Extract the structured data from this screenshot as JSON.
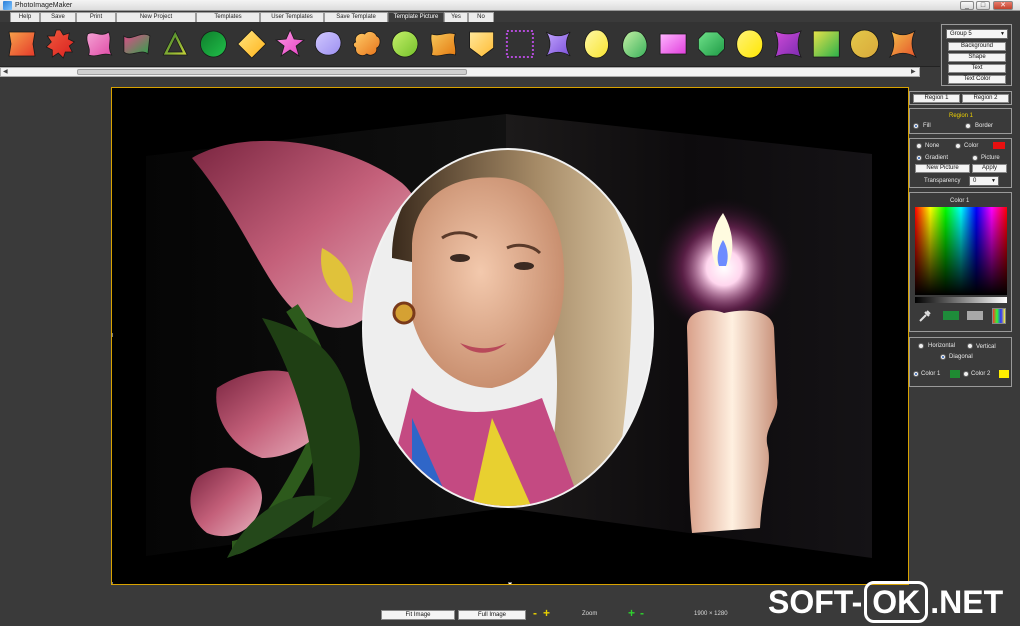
{
  "window": {
    "title": "PhotoImageMaker"
  },
  "menu": [
    {
      "label": "Help",
      "width": 30
    },
    {
      "label": "Save",
      "width": 36
    },
    {
      "label": "Print",
      "width": 40
    },
    {
      "label": "New Project",
      "width": 80
    },
    {
      "label": "Templates",
      "width": 64
    },
    {
      "label": "User Templates",
      "width": 64
    },
    {
      "label": "Save Template",
      "width": 64
    },
    {
      "label": "Template Picture",
      "width": 56,
      "active": true
    },
    {
      "label": "Yes",
      "width": 24
    },
    {
      "label": "No",
      "width": 26
    }
  ],
  "shapes": [
    {
      "name": "bevel-square-red",
      "c1": "#e53a2a",
      "c2": "#f7a14a"
    },
    {
      "name": "starburst-red",
      "c1": "#d91f1f",
      "c2": "#f05a3d"
    },
    {
      "name": "curly-pink",
      "c1": "#e04ba6",
      "c2": "#f4a3d4"
    },
    {
      "name": "wave-green",
      "c1": "#2ea34a",
      "c2": "#e14a8a"
    },
    {
      "name": "triangle-yellow",
      "c1": "#c9d43a",
      "c2": "#2b7a2b"
    },
    {
      "name": "circle-green",
      "c1": "#21c04a",
      "c2": "#0e7d2b"
    },
    {
      "name": "diamond-orange",
      "c1": "#ffb21a",
      "c2": "#ffe680"
    },
    {
      "name": "star-pink",
      "c1": "#e43fc3",
      "c2": "#ff9be5"
    },
    {
      "name": "blob-lavender",
      "c1": "#9c8ff0",
      "c2": "#d1c8ff"
    },
    {
      "name": "cloud-orange",
      "c1": "#e8731a",
      "c2": "#ffcf6a"
    },
    {
      "name": "circle-lime",
      "c1": "#74c12a",
      "c2": "#c6f06a"
    },
    {
      "name": "ribbon-orange",
      "c1": "#e57b12",
      "c2": "#f6c75a"
    },
    {
      "name": "badge-orange",
      "c1": "#ffbb33",
      "c2": "#ffe79a"
    },
    {
      "name": "stitched-frame",
      "c1": "#b24bd8",
      "c2": "#333333"
    },
    {
      "name": "star-violet",
      "c1": "#7a4fd8",
      "c2": "#c2a5ff"
    },
    {
      "name": "oval-yellow",
      "c1": "#f7e32f",
      "c2": "#fff9a8"
    },
    {
      "name": "egg-green",
      "c1": "#38b05a",
      "c2": "#c5f0a5"
    },
    {
      "name": "rect-magenta",
      "c1": "#e03fdc",
      "c2": "#ffb6ff"
    },
    {
      "name": "octagon-green",
      "c1": "#1e9a45",
      "c2": "#6fe28a"
    },
    {
      "name": "oval-yellow-2",
      "c1": "#ffe600",
      "c2": "#fff37a"
    },
    {
      "name": "square-purple",
      "c1": "#7b2bb0",
      "c2": "#d04bd8"
    },
    {
      "name": "square-lime",
      "c1": "#2ab04a",
      "c2": "#e8e24a"
    },
    {
      "name": "circle-gradient",
      "c1": "#d9a93a",
      "c2": "#e3c84a"
    },
    {
      "name": "sail-orange",
      "c1": "#e5532a",
      "c2": "#f3c04a"
    }
  ],
  "right_panel": {
    "group_select": "Group 5",
    "buttons": [
      "Background",
      "Shape",
      "Text",
      "Text Color"
    ],
    "regions": [
      "Region 1",
      "Region 2"
    ],
    "region_title": "Region 1",
    "fill_label": "Fill",
    "border_label": "Border",
    "none_label": "None",
    "color_label": "Color",
    "gradient_label": "Gradient",
    "picture_label": "Picture",
    "new_picture": "New Picture",
    "apply": "Apply",
    "transparency_label": "Transparency",
    "transparency_value": "0",
    "color_title": "Color 1",
    "horizontal_label": "Horizontal",
    "vertical_label": "Vertical",
    "diagonal_label": "Diagonal",
    "color1_label": "Color 1",
    "color2_label": "Color 2",
    "accent_red": "#e81010",
    "swatch_green": "#1e8c3a",
    "swatch_gray": "#a8a8a8",
    "color1_swatch": "#1f8a32",
    "color2_swatch": "#ffee00"
  },
  "bottom": {
    "fit_image": "Fit Image",
    "full_image": "Full Image",
    "zoom_label": "Zoom",
    "plus": "+",
    "minus": "-",
    "dimensions": "1900 × 1280"
  },
  "watermark": {
    "left": "SOFT-",
    "box": "OK",
    "right": ".NET"
  },
  "colors": {
    "accent": "#d8a200",
    "panel_border": "#9a9a9a"
  }
}
